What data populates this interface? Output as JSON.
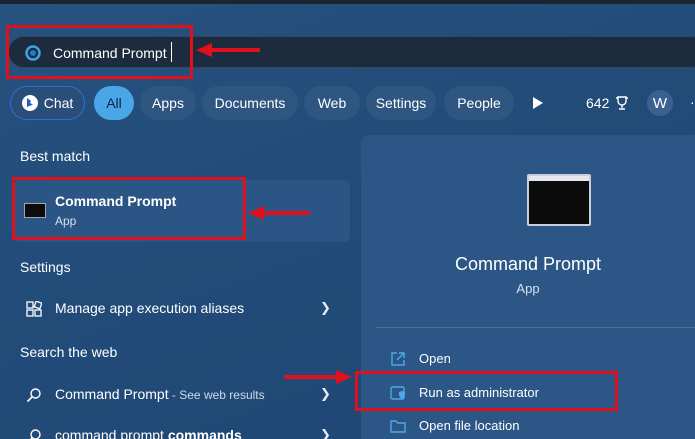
{
  "search": {
    "value": "Command Prompt"
  },
  "filters": {
    "chat": "Chat",
    "all": "All",
    "apps": "Apps",
    "documents": "Documents",
    "web": "Web",
    "settings": "Settings",
    "people": "People",
    "points": "642",
    "avatar_initial": "W"
  },
  "best_match": {
    "heading": "Best match",
    "title": "Command Prompt",
    "subtitle": "App"
  },
  "settings_section": {
    "heading": "Settings",
    "items": [
      {
        "label": "Manage app execution aliases"
      }
    ]
  },
  "web_section": {
    "heading": "Search the web",
    "items": [
      {
        "label": "Command Prompt",
        "suffix": " - See web results"
      },
      {
        "label": "command prompt ",
        "bold": "commands"
      }
    ]
  },
  "preview": {
    "title": "Command Prompt",
    "subtitle": "App",
    "actions": [
      {
        "label": "Open"
      },
      {
        "label": "Run as administrator"
      },
      {
        "label": "Open file location"
      }
    ]
  },
  "colors": {
    "accent": "#4ba6e8",
    "highlight": "#e0101c",
    "background": "#224c79"
  }
}
